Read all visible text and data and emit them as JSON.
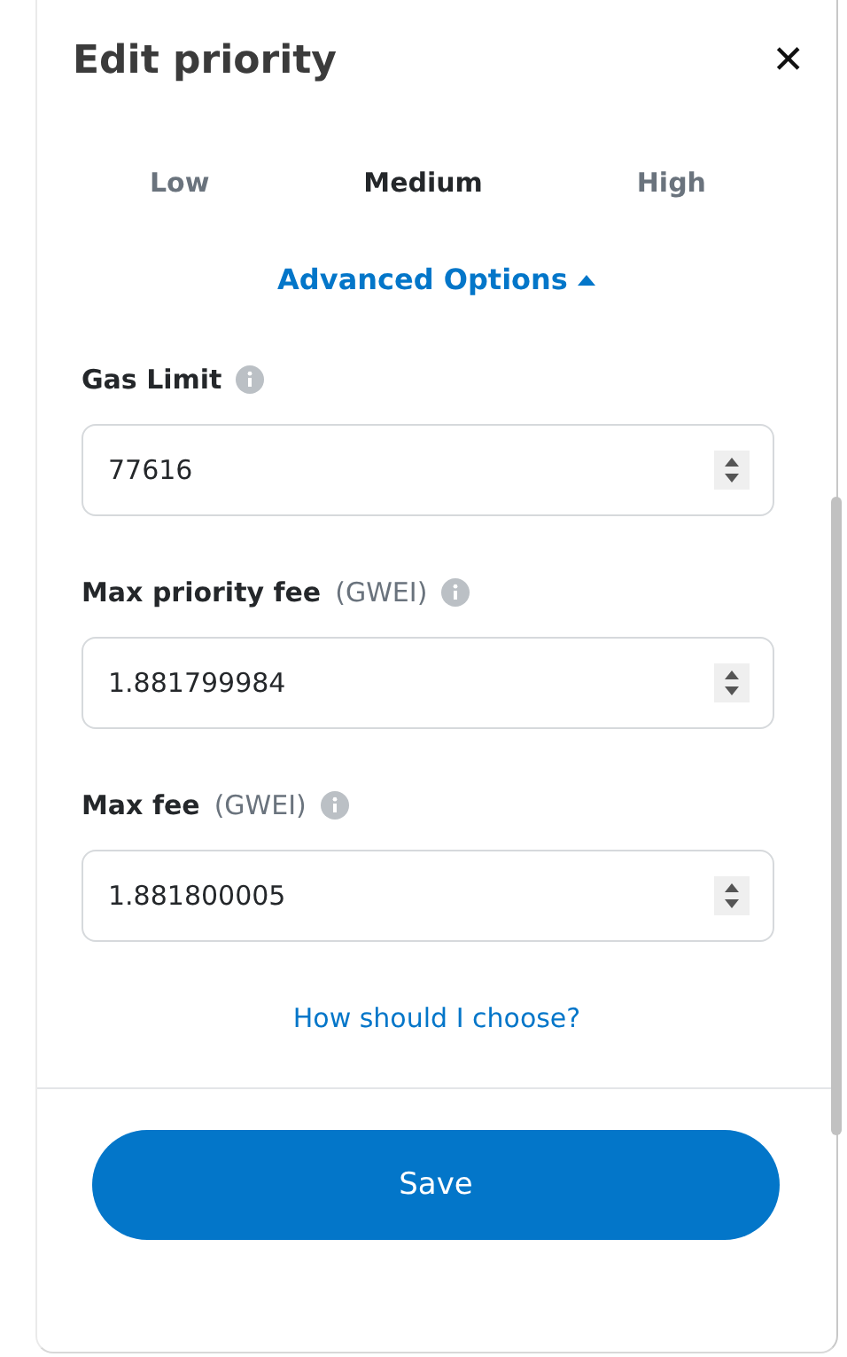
{
  "title": "Edit priority",
  "close": "✕",
  "tabs": [
    {
      "label": "Low",
      "selected": false
    },
    {
      "label": "Medium",
      "selected": true
    },
    {
      "label": "High",
      "selected": false
    }
  ],
  "advanced": {
    "label": "Advanced Options",
    "expanded": true
  },
  "fields": [
    {
      "label": "Gas Limit",
      "value": "77616"
    },
    {
      "label": "Max priority fee",
      "unit": "(GWEI)",
      "value": "1.881799984"
    },
    {
      "label": "Max fee",
      "unit": "(GWEI)",
      "value": "1.881800005"
    }
  ],
  "help_link": "How should I choose?",
  "save": "Save"
}
